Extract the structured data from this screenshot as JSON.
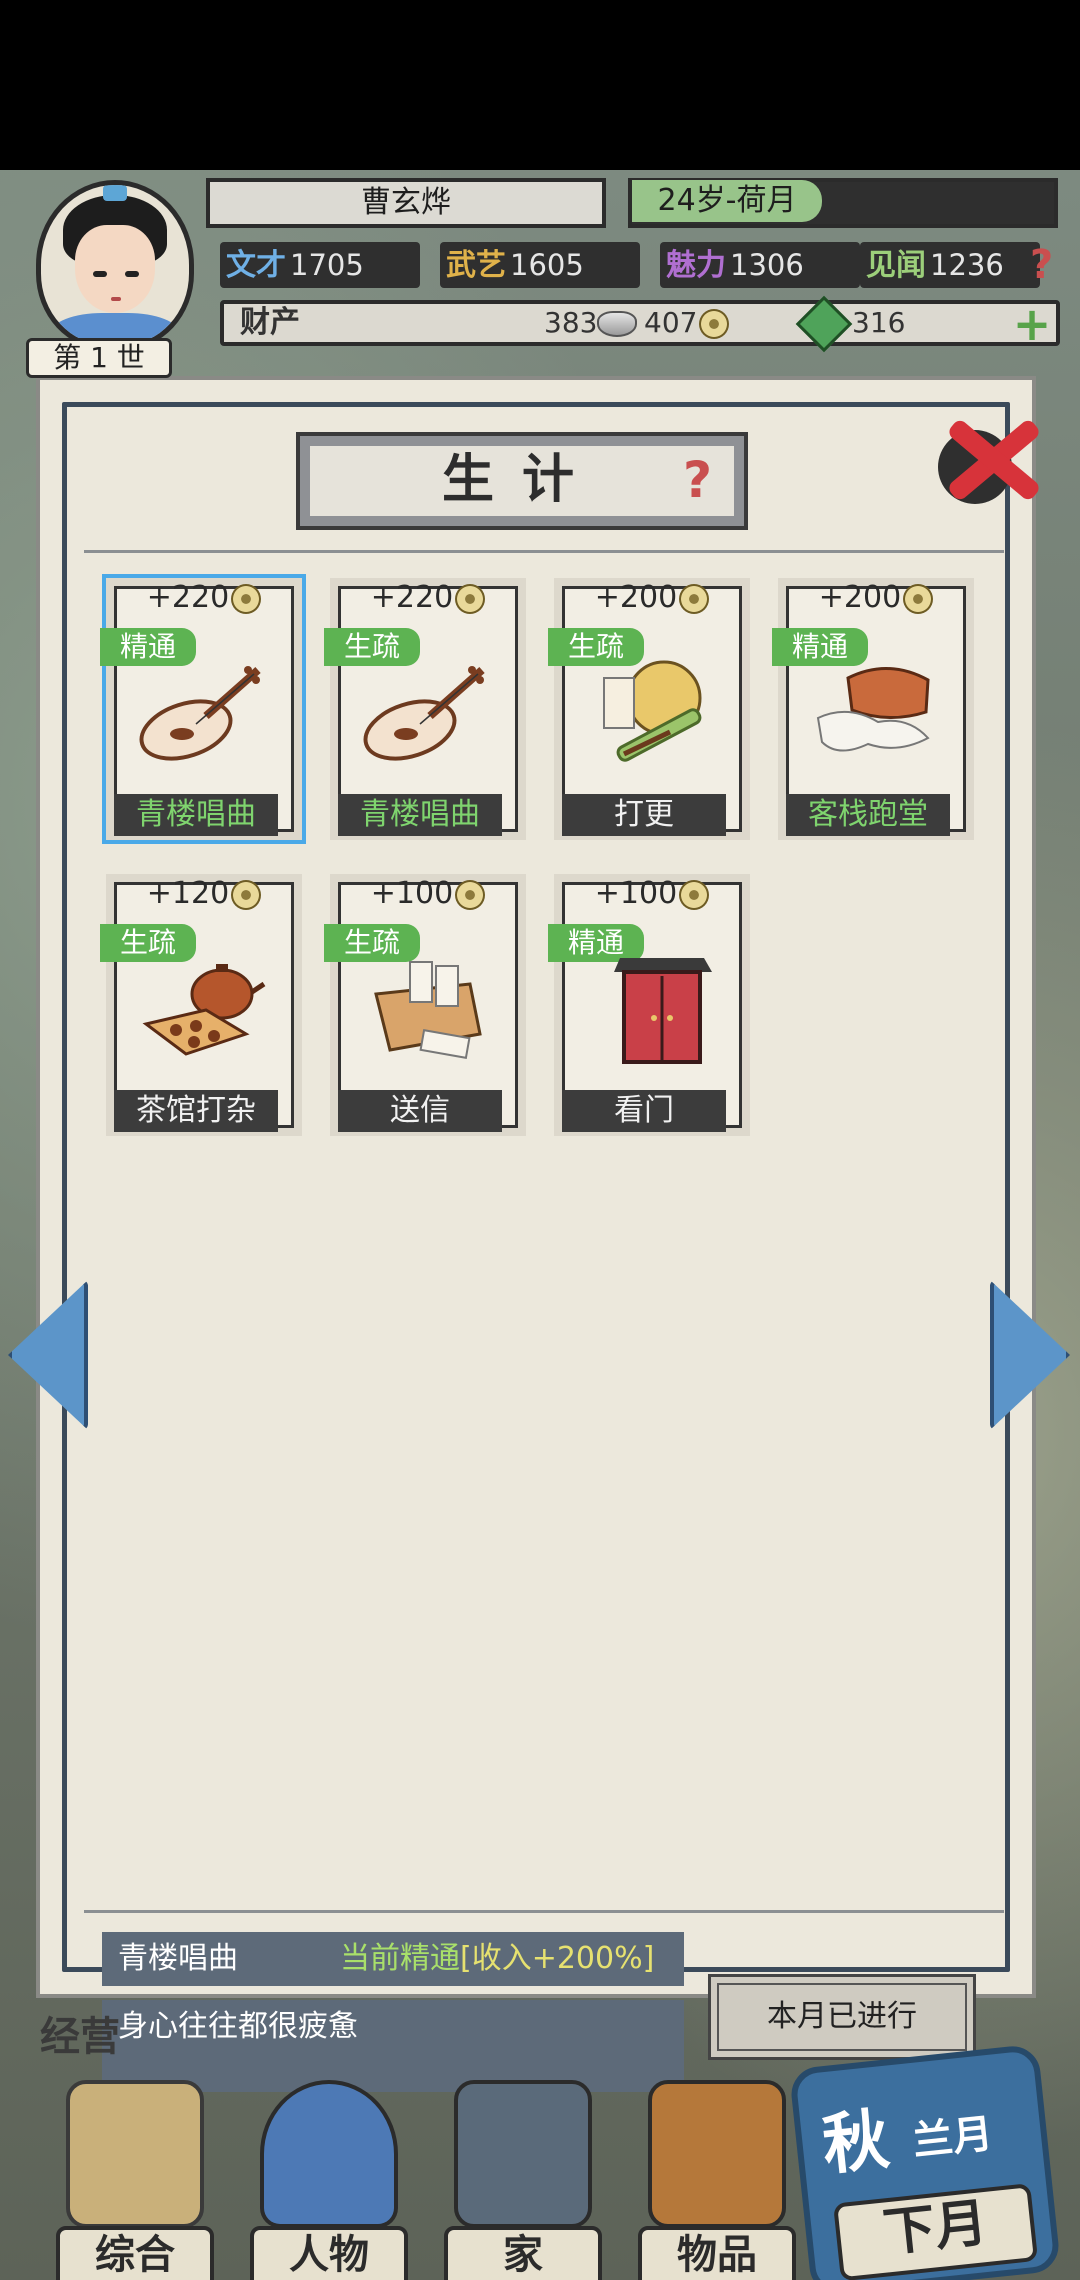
{
  "character": {
    "name": "曹玄烨",
    "age_month": "24岁-荷月",
    "generation": "第 1 世",
    "stats": [
      {
        "label": "文才",
        "value": "1705",
        "color": "#6fb0e6"
      },
      {
        "label": "武艺",
        "value": "1605",
        "color": "#e0b24a"
      },
      {
        "label": "魅力",
        "value": "1306",
        "color": "#b06fd1"
      },
      {
        "label": "见闻",
        "value": "1236",
        "color": "#9ccf7a"
      }
    ],
    "wealth_label": "财产",
    "silver": "383",
    "coins": "407",
    "jade": "316"
  },
  "panel": {
    "title": "生计",
    "help_icon": "question-icon",
    "close_icon": "close-icon"
  },
  "jobs": [
    {
      "income": "+220",
      "skill": "精通",
      "name": "青楼唱曲",
      "icon": "pipa-icon",
      "selected": true
    },
    {
      "income": "+220",
      "skill": "生疏",
      "name": "青楼唱曲",
      "icon": "pipa-icon",
      "selected": false
    },
    {
      "income": "+200",
      "skill": "生疏",
      "name": "打更",
      "icon": "gong-icon",
      "selected": false
    },
    {
      "income": "+200",
      "skill": "精通",
      "name": "客栈跑堂",
      "icon": "cloth-icon",
      "selected": false
    },
    {
      "income": "+120",
      "skill": "生疏",
      "name": "茶馆打杂",
      "icon": "teapot-icon",
      "selected": false
    },
    {
      "income": "+100",
      "skill": "生疏",
      "name": "送信",
      "icon": "letters-icon",
      "selected": false
    },
    {
      "income": "+100",
      "skill": "精通",
      "name": "看门",
      "icon": "gate-icon",
      "selected": false
    }
  ],
  "detail": {
    "job_name": "青楼唱曲",
    "status_prefix": "当前精通",
    "status_bonus": "[收入+200%]",
    "description": "身心往往都很疲惫",
    "action_button": "本月已进行"
  },
  "nav": {
    "section": "经营",
    "items": [
      "综合",
      "人物",
      "家",
      "物品"
    ],
    "season": "秋",
    "month": "兰月",
    "next_button": "下月"
  }
}
